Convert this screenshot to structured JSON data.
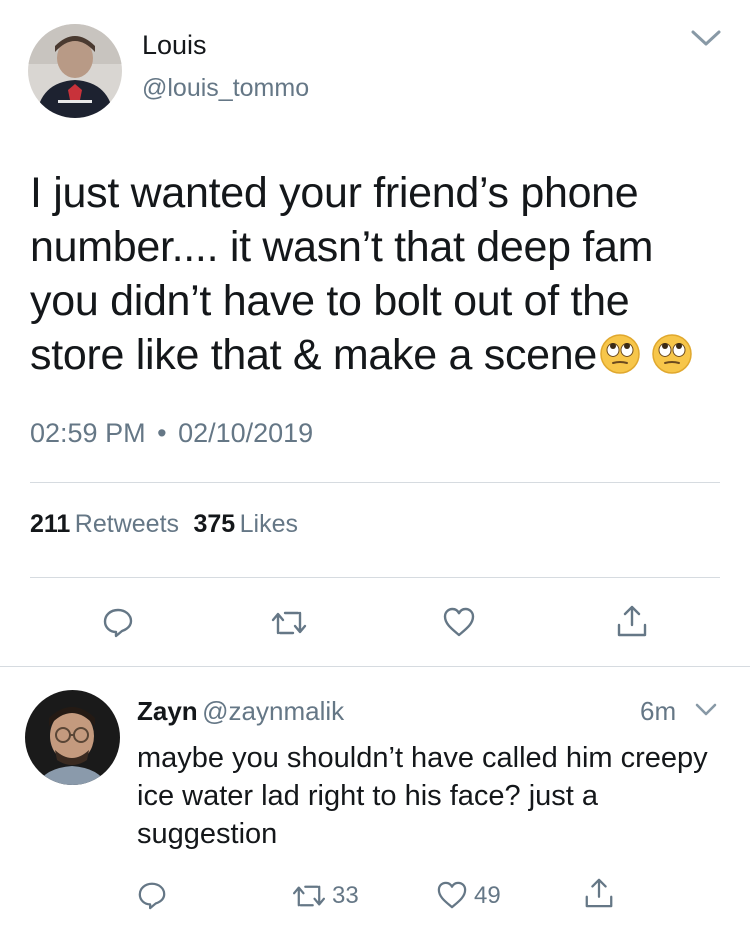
{
  "tweet": {
    "author_name": "Louis",
    "author_handle": "@louis_tommo",
    "text": "I just wanted your friend’s phone number.... it wasn’t that deep fam you didn’t have to bolt out of the store like that & make a scene",
    "emoji": "face-with-rolling-eyes",
    "time": "02:59 PM",
    "separator": "•",
    "date": "02/10/2019",
    "retweets_count": "211",
    "retweets_label": "Retweets",
    "likes_count": "375",
    "likes_label": "Likes"
  },
  "reply": {
    "author_name": "Zayn",
    "author_handle": "@zaynmalik",
    "time_ago": "6m",
    "text": "maybe you shouldn’t have called him creepy ice water lad right to his face? just a suggestion",
    "retweets_count": "33",
    "likes_count": "49"
  },
  "colors": {
    "text": "#14171a",
    "secondary": "#657786",
    "divider": "#d6dbe0",
    "icon": "#657786"
  },
  "icons": [
    "chevron-down-icon",
    "reply-icon",
    "retweet-icon",
    "like-icon",
    "share-icon"
  ]
}
